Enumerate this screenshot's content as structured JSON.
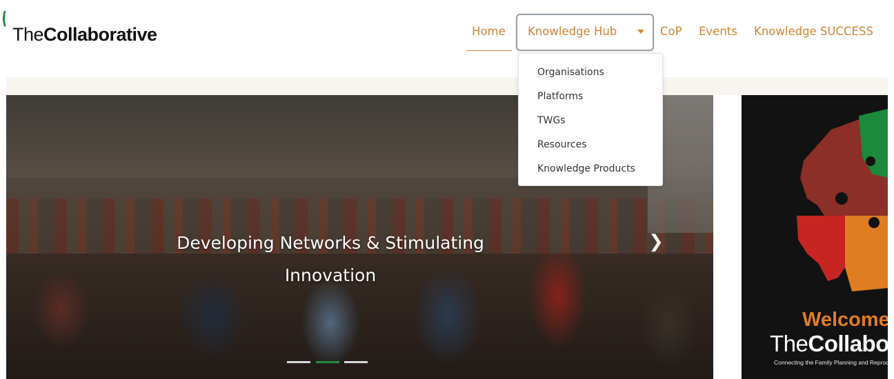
{
  "brand": {
    "prefix": "The",
    "name": "Collaborative"
  },
  "nav": {
    "home": "Home",
    "knowledge_hub": "Knowledge Hub",
    "cop": "CoP",
    "events": "Events",
    "knowledge_success": "Knowledge SUCCESS"
  },
  "dropdown": {
    "items": [
      "Organisations",
      "Platforms",
      "TWGs",
      "Resources",
      "Knowledge Products"
    ]
  },
  "hero": {
    "caption_line1": "Developing Networks & Stimulating",
    "caption_line2": "Innovation",
    "next_icon": "chevron-right-icon",
    "slide_count": 3,
    "active_slide": 2
  },
  "side_panel": {
    "welcome": "Welcome",
    "logo_prefix": "The",
    "logo_name": "Collabo",
    "tagline": "Connecting the Family Planning and Reprod"
  },
  "colors": {
    "accent": "#d08236",
    "active_indicator": "#1f8e3c",
    "welcome": "#e07c22"
  }
}
